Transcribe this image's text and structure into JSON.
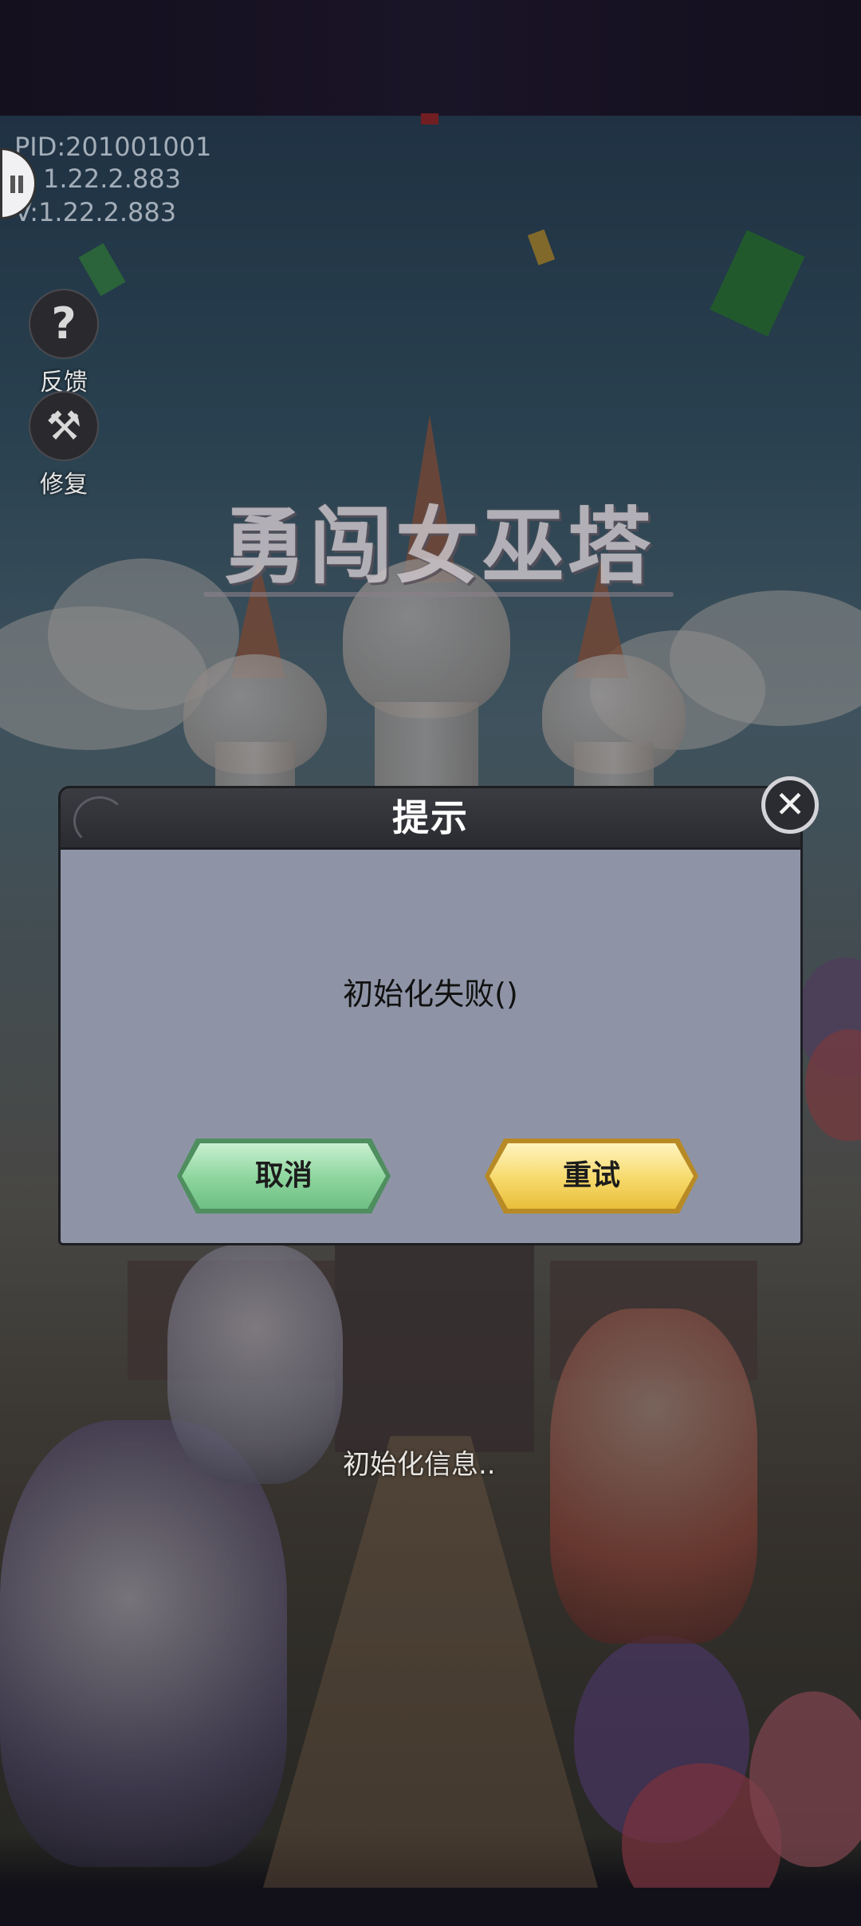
{
  "hud": {
    "pid": "PID:201001001",
    "version_line_1": "1.22.2.883",
    "version_line_2": "V:1.22.2.883",
    "feedback": {
      "icon": "question-icon",
      "glyph": "?",
      "label": "反馈"
    },
    "repair": {
      "icon": "wrench-icon",
      "glyph": "⚒",
      "label": "修复"
    }
  },
  "logo": {
    "title": "勇闯女巫塔"
  },
  "loading": {
    "status": "初始化信息.."
  },
  "dialog": {
    "title": "提示",
    "message": "初始化失败()",
    "close_icon": "close-icon",
    "close_glyph": "✕",
    "cancel_label": "取消",
    "retry_label": "重试"
  },
  "colors": {
    "dialog_body": "#8e94a6",
    "dialog_header": "#2f3035",
    "cancel_button": "#8bd49c",
    "retry_button": "#f6d96a"
  }
}
